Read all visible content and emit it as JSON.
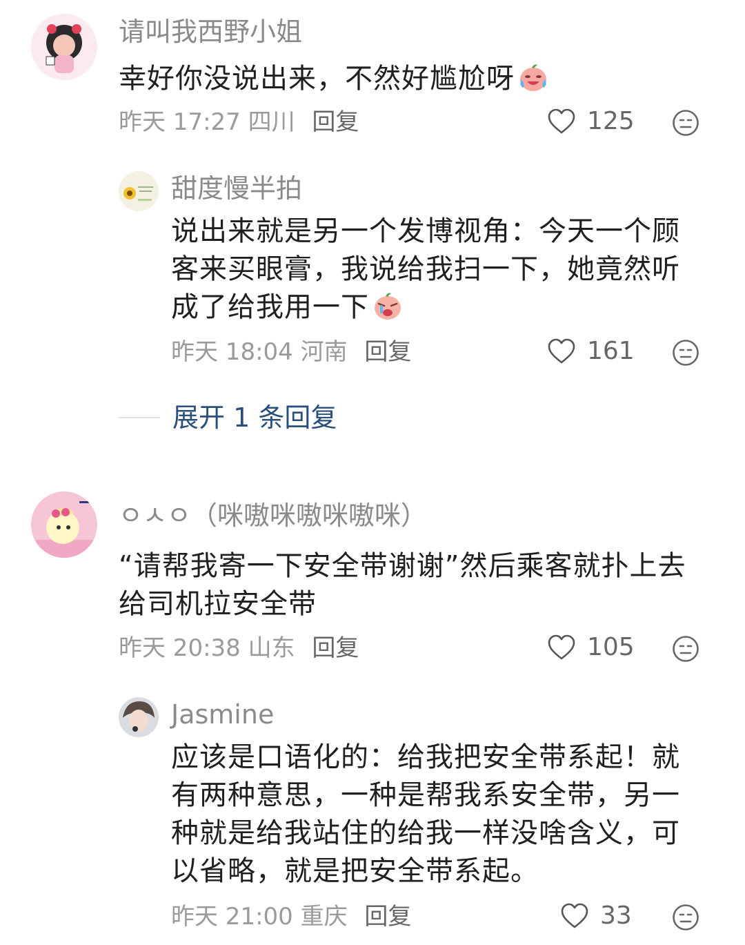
{
  "comments": [
    {
      "username": "请叫我西野小姐",
      "text": "幸好你没说出来，不然好尴尬呀",
      "emoji_icon": "crying-laugh-peach-emoji",
      "time": "昨天 17:27",
      "location": "四川",
      "reply_label": "回复",
      "likes": "125"
    },
    {
      "username": "甜度慢半拍",
      "text": "说出来就是另一个发博视角：今天一个顾客来买眼膏，我说给我扫一下，她竟然听成了给我用一下",
      "emoji_icon": "crying-peach-emoji",
      "time": "昨天 18:04",
      "location": "河南",
      "reply_label": "回复",
      "likes": "161"
    },
    {
      "username": "ㅇㅅㅇ（咪嗷咪嗷咪嗷咪）",
      "text": "“请帮我寄一下安全带谢谢”然后乘客就扑上去给司机拉安全带",
      "emoji_icon": "",
      "time": "昨天 20:38",
      "location": "山东",
      "reply_label": "回复",
      "likes": "105"
    },
    {
      "username": "Jasmine",
      "text": "应该是口语化的：给我把安全带系起！就有两种意思，一种是帮我系安全带，另一种就是给我站住的给我一样没啥含义，可以省略，就是把安全带系起。",
      "emoji_icon": "",
      "time": "昨天 21:00",
      "location": "重庆",
      "reply_label": "回复",
      "likes": "33"
    }
  ],
  "expand_replies": "展开 1 条回复",
  "icons": {
    "like": "heart-outline-icon",
    "dislike": "meh-face-icon"
  },
  "colors": {
    "link": "#2b4f7d",
    "muted": "#9a9a9a",
    "username": "#8a8a8a"
  }
}
